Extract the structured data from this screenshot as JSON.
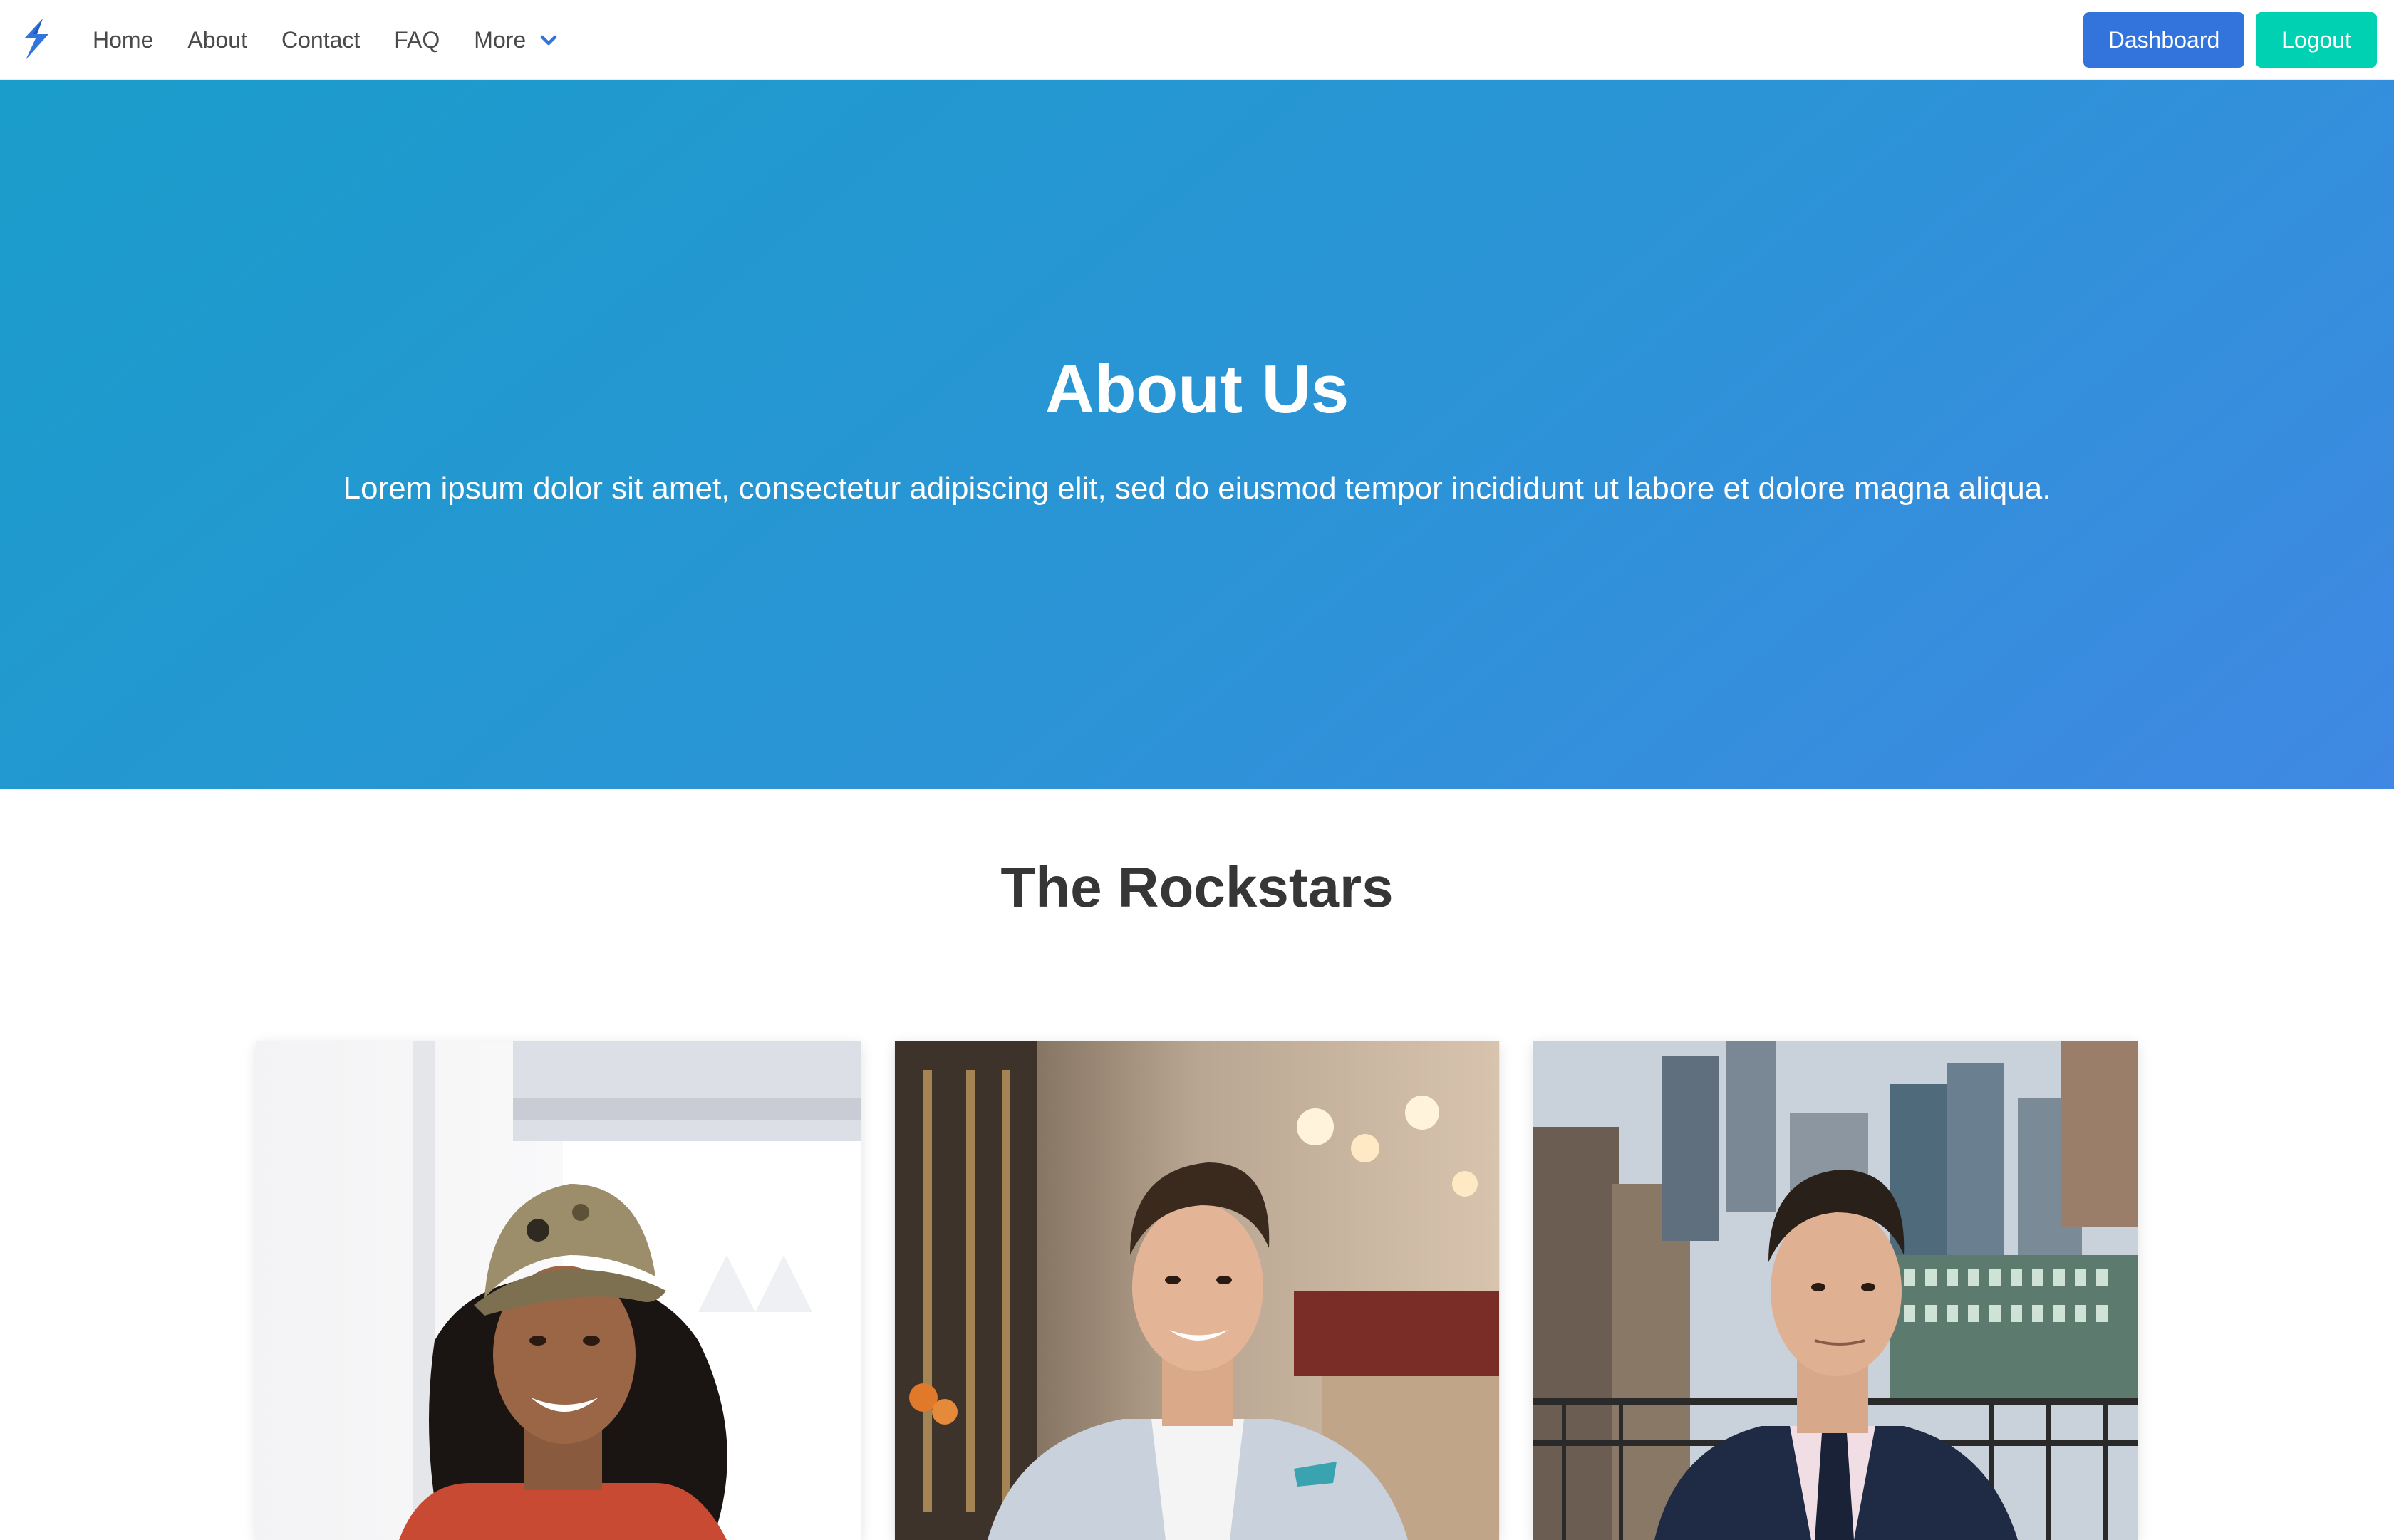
{
  "navbar": {
    "brand_icon": "lightning-bolt-icon",
    "links": [
      {
        "label": "Home"
      },
      {
        "label": "About"
      },
      {
        "label": "Contact"
      },
      {
        "label": "FAQ"
      },
      {
        "label": "More",
        "icon": "chevron-down-icon"
      }
    ],
    "buttons": {
      "dashboard": "Dashboard",
      "logout": "Logout"
    }
  },
  "hero": {
    "title": "About Us",
    "subtitle": "Lorem ipsum dolor sit amet, consectetur adipiscing elit, sed do eiusmod tempor incididunt ut labore et dolore magna aliqua."
  },
  "team": {
    "title": "The Rockstars",
    "members": [
      {
        "photo": "woman-in-cap-photo"
      },
      {
        "photo": "man-in-restaurant-photo"
      },
      {
        "photo": "man-in-suit-city-photo"
      }
    ]
  },
  "colors": {
    "primary": "#3273dc",
    "success": "#00d1b2",
    "hero_gradient_start": "#1a9dca",
    "hero_gradient_end": "#3f88e3",
    "brand": "#3273dc"
  }
}
